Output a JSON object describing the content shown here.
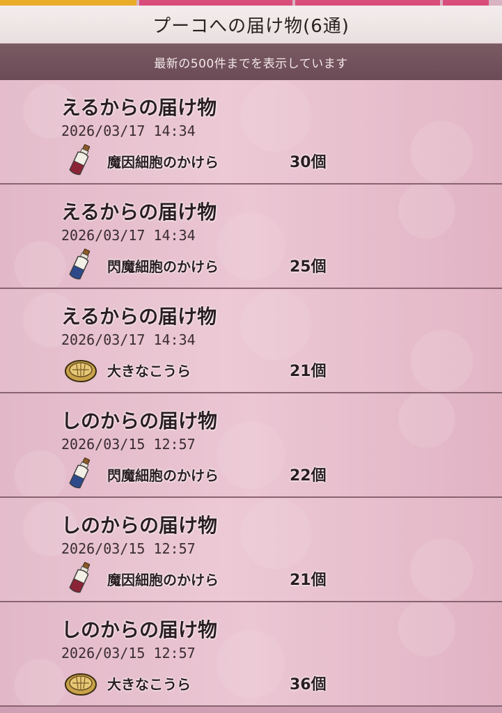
{
  "header": {
    "title": "プーコへの届け物(6通)"
  },
  "notice": {
    "text": "最新の500件までを表示しています"
  },
  "colors": {
    "tab_active": "#e9ad2a",
    "tab_inactive": "#d84d7b",
    "notice_bg": "#6b4b56",
    "list_bg": "#e4bccb"
  },
  "items": [
    {
      "title": "えるからの届け物",
      "date": "2026/03/17  14:34",
      "icon": "bottle-icon",
      "name": "魔因細胞のかけら",
      "count": "30個"
    },
    {
      "title": "えるからの届け物",
      "date": "2026/03/17  14:34",
      "icon": "bottle-icon",
      "name": "閃魔細胞のかけら",
      "count": "25個"
    },
    {
      "title": "えるからの届け物",
      "date": "2026/03/17  14:34",
      "icon": "shell-icon",
      "name": "大きなこうら",
      "count": "21個"
    },
    {
      "title": "しのからの届け物",
      "date": "2026/03/15  12:57",
      "icon": "bottle-icon",
      "name": "閃魔細胞のかけら",
      "count": "22個"
    },
    {
      "title": "しのからの届け物",
      "date": "2026/03/15  12:57",
      "icon": "bottle-icon",
      "name": "魔因細胞のかけら",
      "count": "21個"
    },
    {
      "title": "しのからの届け物",
      "date": "2026/03/15  12:57",
      "icon": "shell-icon",
      "name": "大きなこうら",
      "count": "36個"
    }
  ]
}
